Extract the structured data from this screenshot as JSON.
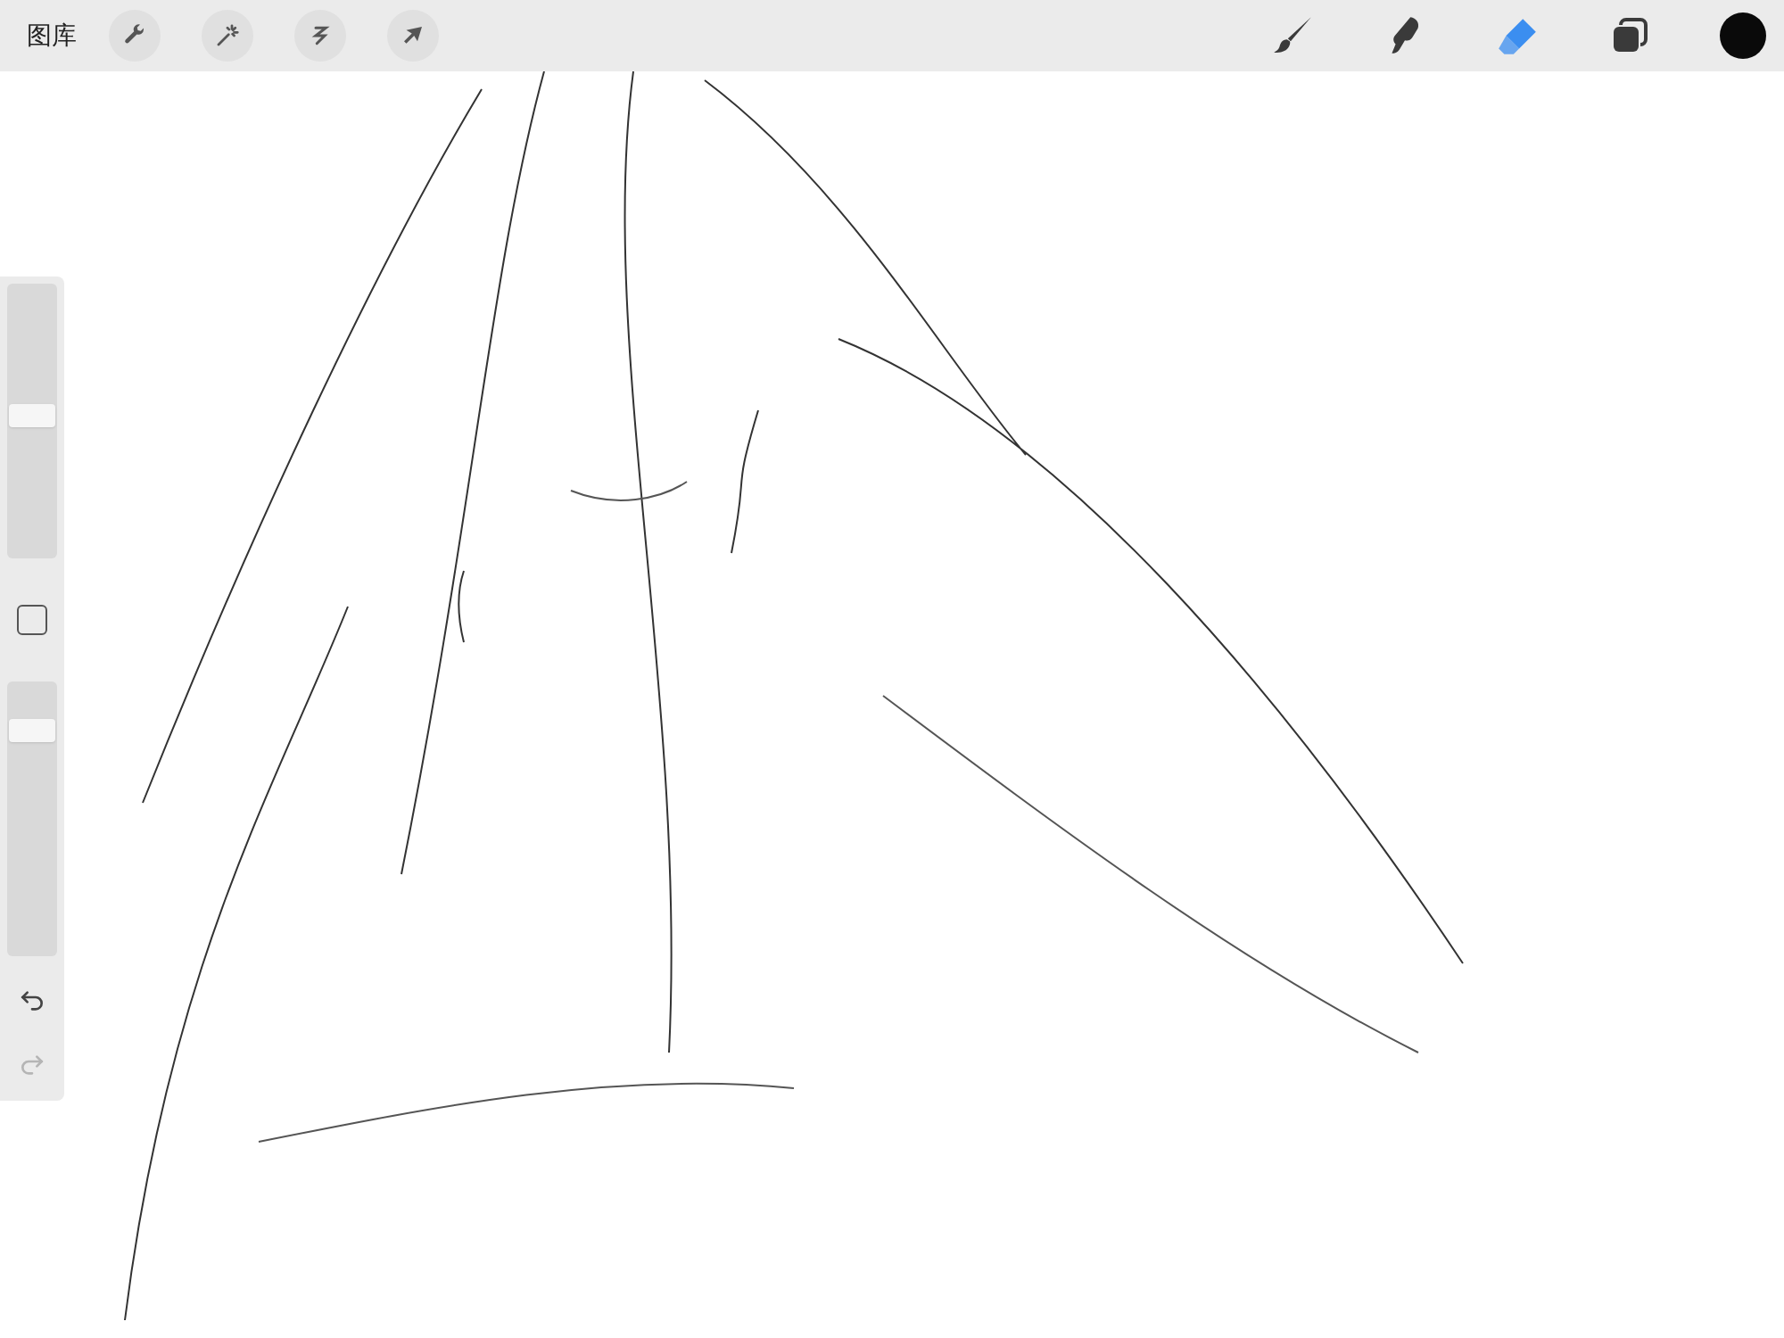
{
  "top_bar": {
    "gallery": "图库",
    "actions": [
      {
        "kind": "wrench"
      },
      {
        "kind": "wand"
      },
      {
        "kind": "select"
      },
      {
        "kind": "transform"
      }
    ],
    "tools": [
      {
        "kind": "brush",
        "selected": false
      },
      {
        "kind": "smudge",
        "selected": false
      },
      {
        "kind": "eraser",
        "selected": true
      }
    ],
    "color": "#0a0a0a"
  },
  "sidebar": {
    "size_slider": {
      "level": 0.52
    },
    "opacity_slider": {
      "level": 0.85
    },
    "undo": {
      "disabled": false
    },
    "redo": {
      "disabled": true
    }
  }
}
